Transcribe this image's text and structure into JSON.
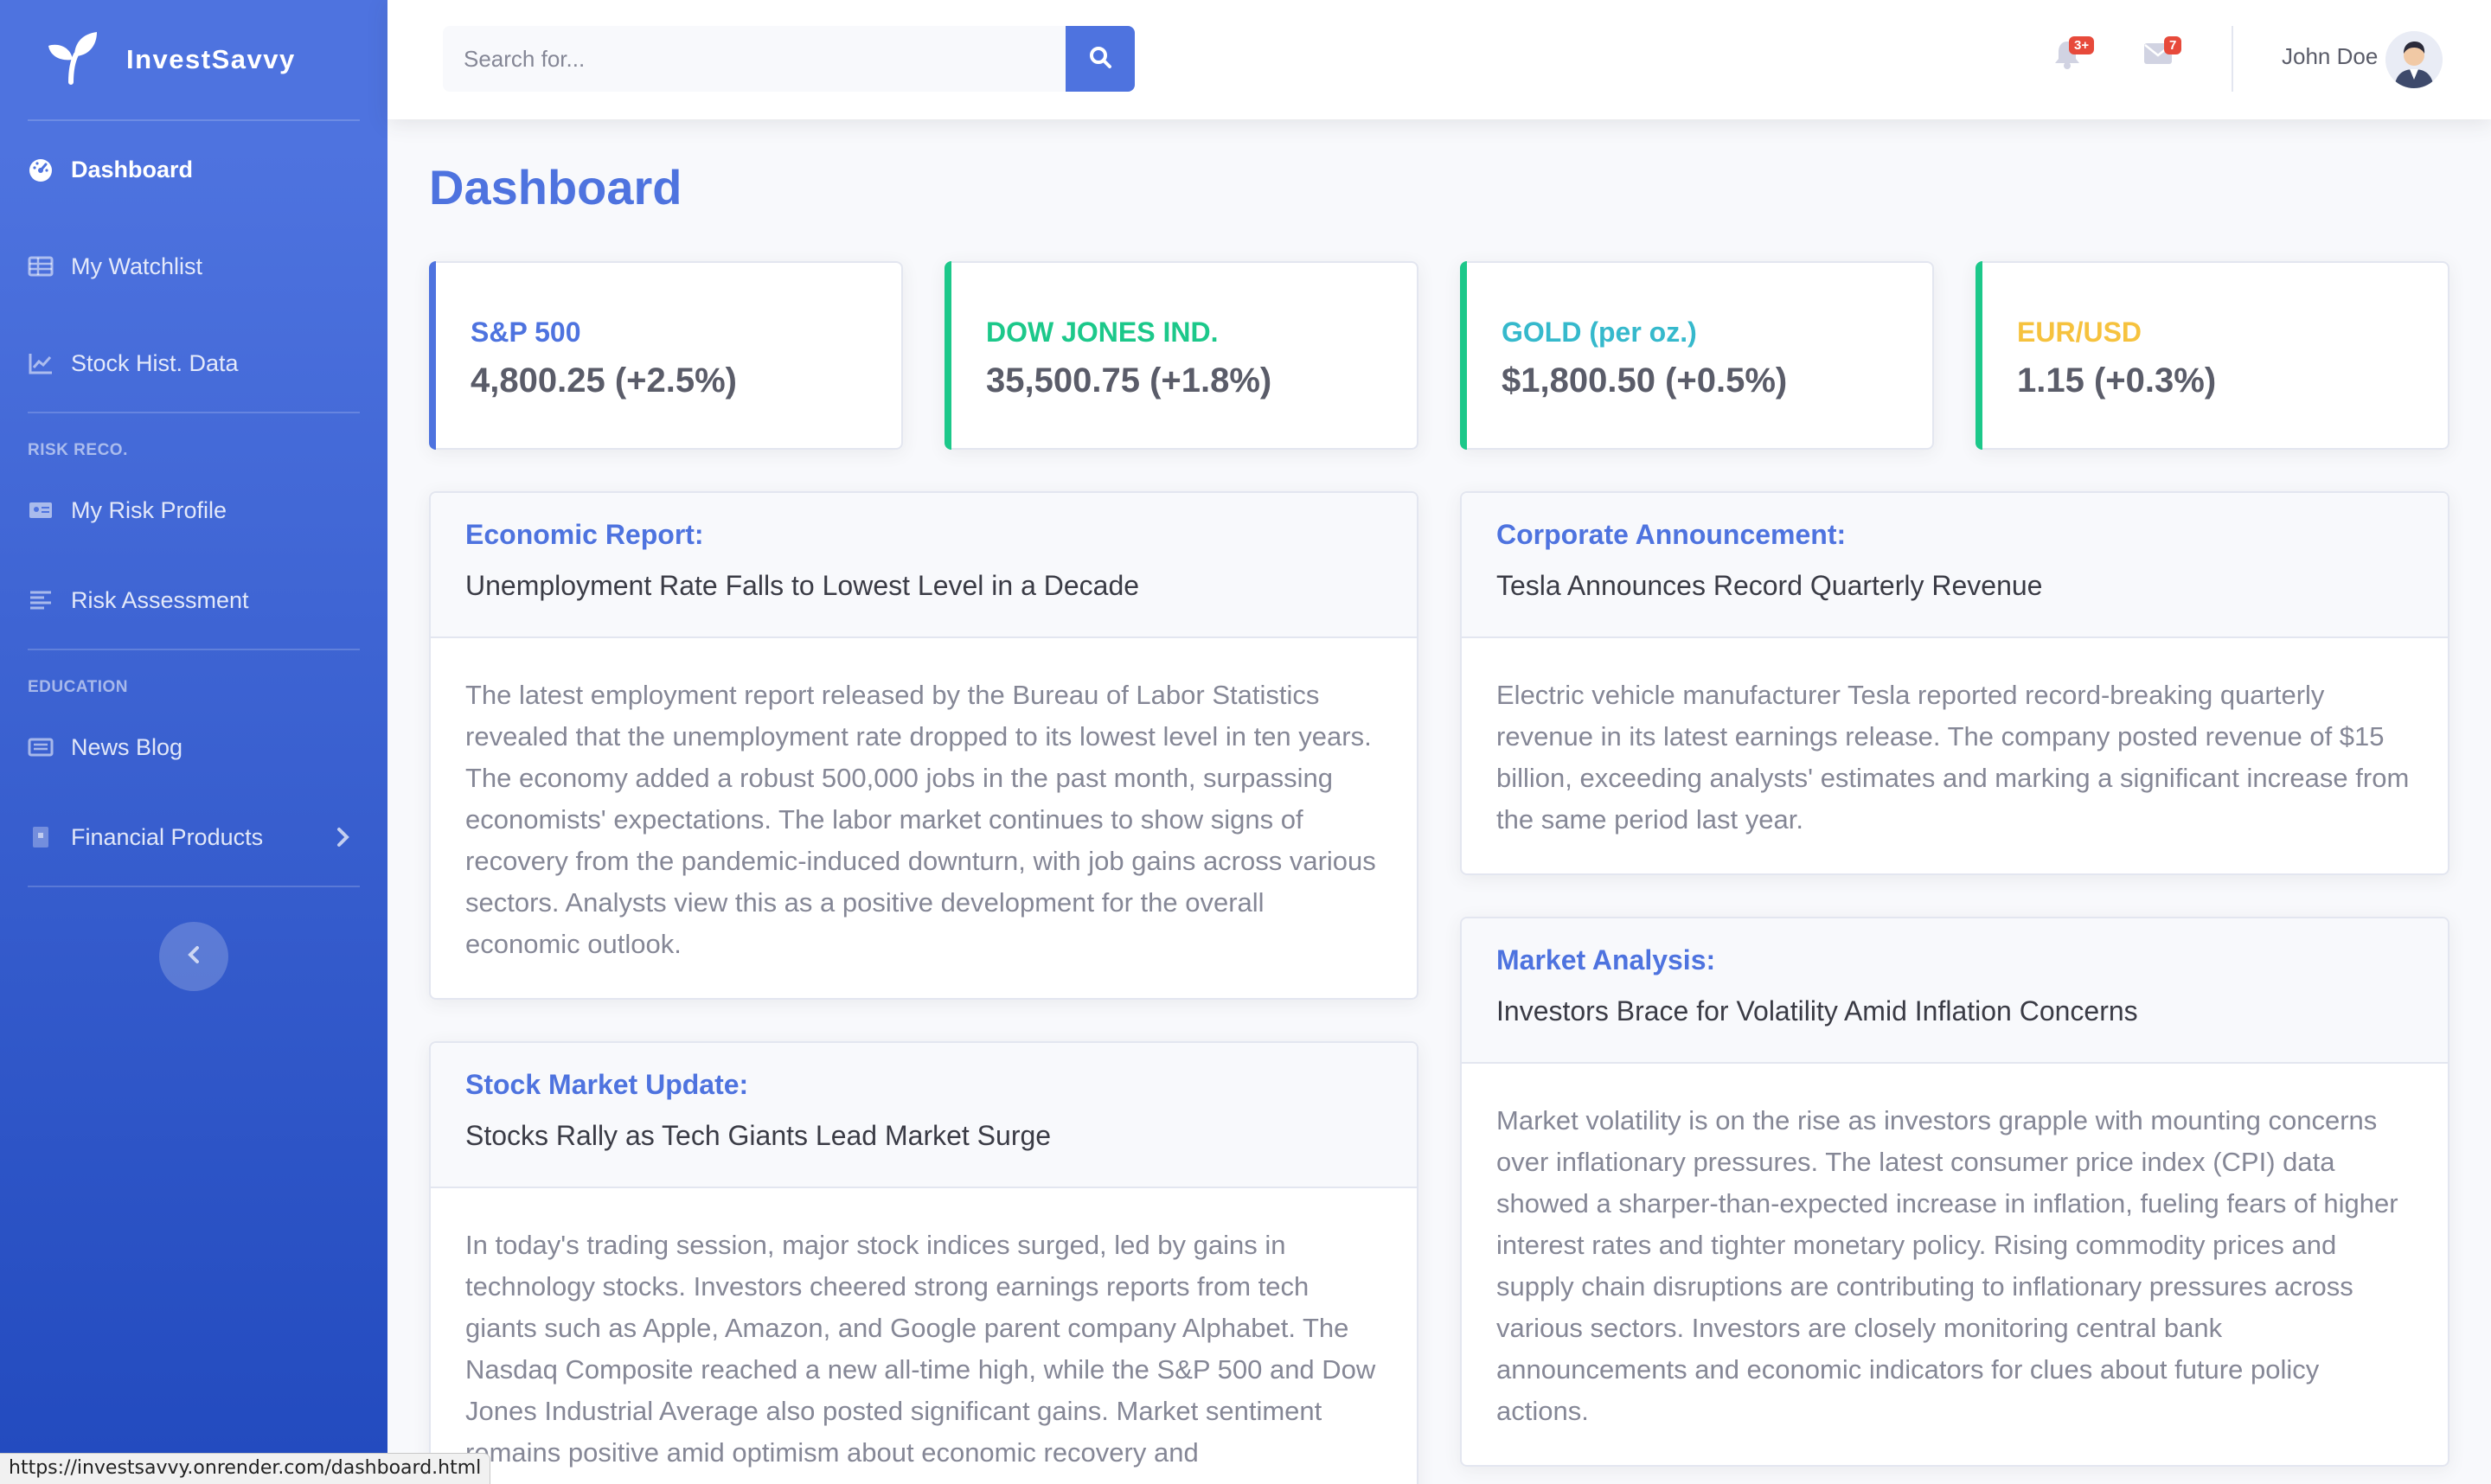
{
  "brand": {
    "name": "InvestSavvy"
  },
  "sidebar": {
    "items": [
      {
        "label": "Dashboard",
        "icon": "tachometer-icon",
        "active": true
      },
      {
        "label": "My Watchlist",
        "icon": "table-icon"
      },
      {
        "label": "Stock Hist. Data",
        "icon": "chart-line-icon"
      }
    ],
    "heading_risk": "RISK RECO.",
    "risk_items": [
      {
        "label": "My Risk Profile",
        "icon": "id-card-icon"
      },
      {
        "label": "Risk Assessment",
        "icon": "align-left-icon"
      }
    ],
    "heading_education": "EDUCATION",
    "education_items": [
      {
        "label": "News Blog",
        "icon": "newspaper-icon"
      },
      {
        "label": "Financial Products",
        "icon": "book-icon"
      }
    ]
  },
  "topbar": {
    "search_placeholder": "Search for...",
    "alerts_badge": "3+",
    "messages_badge": "7",
    "user_name": "John Doe"
  },
  "page": {
    "title": "Dashboard"
  },
  "stats": [
    {
      "label": "S&P 500",
      "value": "4,800.25 (+2.5%)",
      "color": "#4e73df"
    },
    {
      "label": "DOW JONES IND.",
      "value": "35,500.75 (+1.8%)",
      "color": "#1cc88a"
    },
    {
      "label": "GOLD (per oz.)",
      "value": "$1,800.50 (+0.5%)",
      "color": "#36b9cc"
    },
    {
      "label": "EUR/USD",
      "value": "1.15 (+0.3%)",
      "color": "#f6c23e"
    }
  ],
  "news": [
    {
      "category": "Economic Report:",
      "headline": "Unemployment Rate Falls to Lowest Level in a Decade",
      "body": "The latest employment report released by the Bureau of Labor Statistics revealed that the unemployment rate dropped to its lowest level in ten years. The economy added a robust 500,000 jobs in the past month, surpassing economists' expectations. The labor market continues to show signs of recovery from the pandemic-induced downturn, with job gains across various sectors. Analysts view this as a positive development for the overall economic outlook."
    },
    {
      "category": "Corporate Announcement:",
      "headline": "Tesla Announces Record Quarterly Revenue",
      "body": "Electric vehicle manufacturer Tesla reported record-breaking quarterly revenue in its latest earnings release. The company posted revenue of $15 billion, exceeding analysts' estimates and marking a significant increase from the same period last year."
    },
    {
      "category": "Stock Market Update:",
      "headline": "Stocks Rally as Tech Giants Lead Market Surge",
      "body": "In today's trading session, major stock indices surged, led by gains in technology stocks. Investors cheered strong earnings reports from tech giants such as Apple, Amazon, and Google parent company Alphabet. The Nasdaq Composite reached a new all-time high, while the S&P 500 and Dow Jones Industrial Average also posted significant gains. Market sentiment remains positive amid optimism about economic recovery and"
    },
    {
      "category": "Market Analysis:",
      "headline": "Investors Brace for Volatility Amid Inflation Concerns",
      "body": "Market volatility is on the rise as investors grapple with mounting concerns over inflationary pressures. The latest consumer price index (CPI) data showed a sharper-than-expected increase in inflation, fueling fears of higher interest rates and tighter monetary policy. Rising commodity prices and supply chain disruptions are contributing to inflationary pressures across various sectors. Investors are closely monitoring central bank announcements and economic indicators for clues about future policy actions."
    }
  ],
  "status_bar": {
    "url": "https://investsavvy.onrender.com/dashboard.html"
  }
}
